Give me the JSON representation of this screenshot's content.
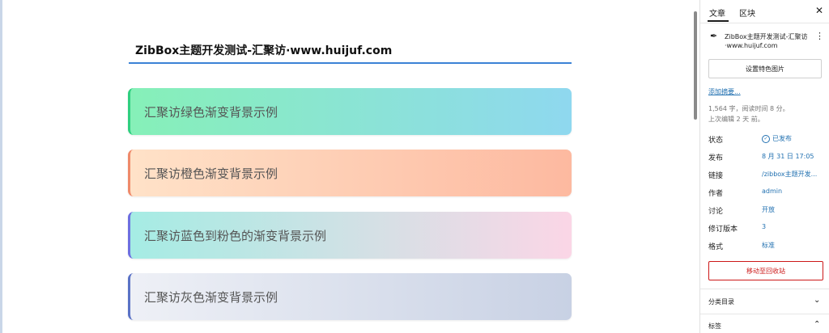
{
  "editor": {
    "title": "ZibBox主题开发测试-汇聚访·www.huijuf.com",
    "blocks": [
      {
        "text": "汇聚访绿色渐变背景示例"
      },
      {
        "text": "汇聚访橙色渐变背景示例"
      },
      {
        "text": "汇聚访蓝色到粉色的渐变背景示例"
      },
      {
        "text": "汇聚访灰色渐变背景示例"
      }
    ]
  },
  "sidebar": {
    "tabs": [
      "文章",
      "区块"
    ],
    "close_icon": "close-icon",
    "post_title": "ZibBox主题开发测试-汇聚访·www.huijuf.com",
    "featured_image_label": "设置特色图片",
    "excerpt_link": "添加摘要...",
    "stats_line1": "1,564 字，阅读时间 8 分。",
    "stats_line2": "上次编辑 2 天 前。",
    "meta": [
      {
        "key": "状态",
        "value": "已发布"
      },
      {
        "key": "发布",
        "value": "8 月 31 日 17:05"
      },
      {
        "key": "链接",
        "value": "/zibbox主题开发..."
      },
      {
        "key": "作者",
        "value": "admin"
      },
      {
        "key": "讨论",
        "value": "开放"
      },
      {
        "key": "修订版本",
        "value": "3"
      },
      {
        "key": "格式",
        "value": "标准"
      }
    ],
    "trash_label": "移动至回收站",
    "panels": [
      {
        "label": "分类目录",
        "state": "collapsed"
      },
      {
        "label": "标签",
        "state": "expanded"
      }
    ]
  },
  "colors": {
    "accent": "#2271b1",
    "danger": "#cc1818",
    "title_underline": "#3b82d6"
  }
}
